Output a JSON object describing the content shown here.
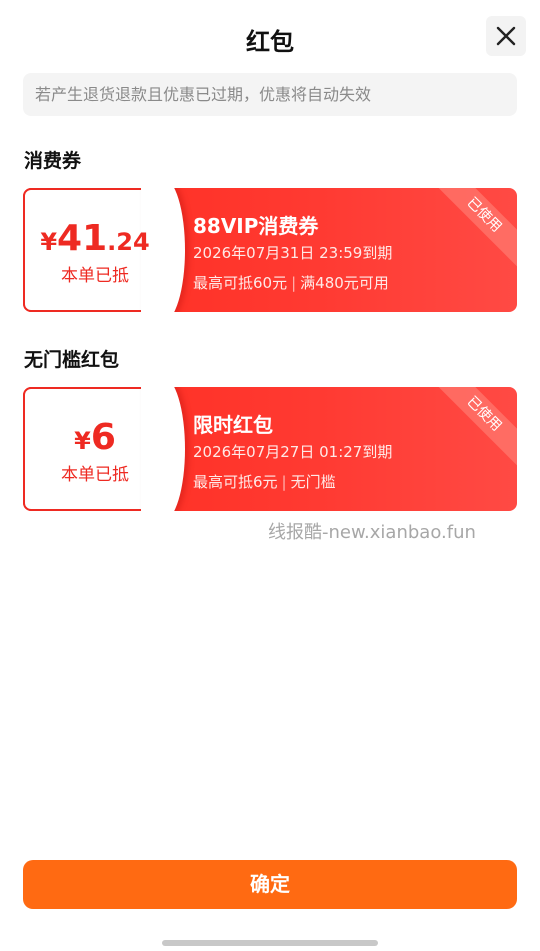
{
  "header": {
    "title": "红包",
    "close_icon": "close-icon"
  },
  "notice": "若产生退货退款且优惠已过期，优惠将自动失效",
  "sections": [
    {
      "title": "消费券",
      "coupon": {
        "currency": "¥",
        "amount_int": "41",
        "amount_dec": ".24",
        "amount_note": "本单已抵",
        "name": "88VIP消费券",
        "expiry": "2026年07月31日 23:59到期",
        "limit": "最高可抵60元",
        "condition": "满480元可用",
        "ribbon": "已使用"
      }
    },
    {
      "title": "无门槛红包",
      "coupon": {
        "currency": "¥",
        "amount_int": "6",
        "amount_dec": "",
        "amount_note": "本单已抵",
        "name": "限时红包",
        "expiry": "2026年07月27日 01:27到期",
        "limit": "最高可抵6元",
        "condition": "无门槛",
        "ribbon": "已使用"
      }
    }
  ],
  "watermark": "线报酷-new.xianbao.fun",
  "footer": {
    "confirm_label": "确定"
  },
  "colors": {
    "accent_red": "#ee2a22",
    "confirm_orange": "#ff6a12"
  }
}
